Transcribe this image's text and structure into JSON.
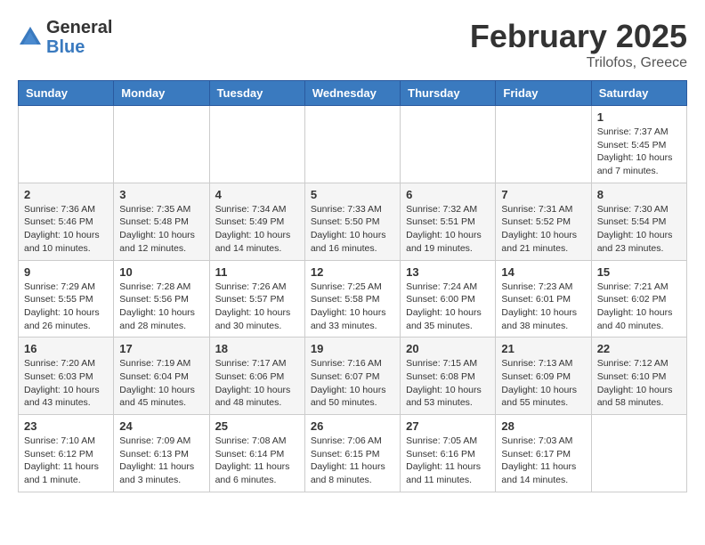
{
  "logo": {
    "general": "General",
    "blue": "Blue"
  },
  "header": {
    "month": "February 2025",
    "location": "Trilofos, Greece"
  },
  "days_of_week": [
    "Sunday",
    "Monday",
    "Tuesday",
    "Wednesday",
    "Thursday",
    "Friday",
    "Saturday"
  ],
  "weeks": [
    [
      {
        "day": "",
        "info": ""
      },
      {
        "day": "",
        "info": ""
      },
      {
        "day": "",
        "info": ""
      },
      {
        "day": "",
        "info": ""
      },
      {
        "day": "",
        "info": ""
      },
      {
        "day": "",
        "info": ""
      },
      {
        "day": "1",
        "info": "Sunrise: 7:37 AM\nSunset: 5:45 PM\nDaylight: 10 hours and 7 minutes."
      }
    ],
    [
      {
        "day": "2",
        "info": "Sunrise: 7:36 AM\nSunset: 5:46 PM\nDaylight: 10 hours and 10 minutes."
      },
      {
        "day": "3",
        "info": "Sunrise: 7:35 AM\nSunset: 5:48 PM\nDaylight: 10 hours and 12 minutes."
      },
      {
        "day": "4",
        "info": "Sunrise: 7:34 AM\nSunset: 5:49 PM\nDaylight: 10 hours and 14 minutes."
      },
      {
        "day": "5",
        "info": "Sunrise: 7:33 AM\nSunset: 5:50 PM\nDaylight: 10 hours and 16 minutes."
      },
      {
        "day": "6",
        "info": "Sunrise: 7:32 AM\nSunset: 5:51 PM\nDaylight: 10 hours and 19 minutes."
      },
      {
        "day": "7",
        "info": "Sunrise: 7:31 AM\nSunset: 5:52 PM\nDaylight: 10 hours and 21 minutes."
      },
      {
        "day": "8",
        "info": "Sunrise: 7:30 AM\nSunset: 5:54 PM\nDaylight: 10 hours and 23 minutes."
      }
    ],
    [
      {
        "day": "9",
        "info": "Sunrise: 7:29 AM\nSunset: 5:55 PM\nDaylight: 10 hours and 26 minutes."
      },
      {
        "day": "10",
        "info": "Sunrise: 7:28 AM\nSunset: 5:56 PM\nDaylight: 10 hours and 28 minutes."
      },
      {
        "day": "11",
        "info": "Sunrise: 7:26 AM\nSunset: 5:57 PM\nDaylight: 10 hours and 30 minutes."
      },
      {
        "day": "12",
        "info": "Sunrise: 7:25 AM\nSunset: 5:58 PM\nDaylight: 10 hours and 33 minutes."
      },
      {
        "day": "13",
        "info": "Sunrise: 7:24 AM\nSunset: 6:00 PM\nDaylight: 10 hours and 35 minutes."
      },
      {
        "day": "14",
        "info": "Sunrise: 7:23 AM\nSunset: 6:01 PM\nDaylight: 10 hours and 38 minutes."
      },
      {
        "day": "15",
        "info": "Sunrise: 7:21 AM\nSunset: 6:02 PM\nDaylight: 10 hours and 40 minutes."
      }
    ],
    [
      {
        "day": "16",
        "info": "Sunrise: 7:20 AM\nSunset: 6:03 PM\nDaylight: 10 hours and 43 minutes."
      },
      {
        "day": "17",
        "info": "Sunrise: 7:19 AM\nSunset: 6:04 PM\nDaylight: 10 hours and 45 minutes."
      },
      {
        "day": "18",
        "info": "Sunrise: 7:17 AM\nSunset: 6:06 PM\nDaylight: 10 hours and 48 minutes."
      },
      {
        "day": "19",
        "info": "Sunrise: 7:16 AM\nSunset: 6:07 PM\nDaylight: 10 hours and 50 minutes."
      },
      {
        "day": "20",
        "info": "Sunrise: 7:15 AM\nSunset: 6:08 PM\nDaylight: 10 hours and 53 minutes."
      },
      {
        "day": "21",
        "info": "Sunrise: 7:13 AM\nSunset: 6:09 PM\nDaylight: 10 hours and 55 minutes."
      },
      {
        "day": "22",
        "info": "Sunrise: 7:12 AM\nSunset: 6:10 PM\nDaylight: 10 hours and 58 minutes."
      }
    ],
    [
      {
        "day": "23",
        "info": "Sunrise: 7:10 AM\nSunset: 6:12 PM\nDaylight: 11 hours and 1 minute."
      },
      {
        "day": "24",
        "info": "Sunrise: 7:09 AM\nSunset: 6:13 PM\nDaylight: 11 hours and 3 minutes."
      },
      {
        "day": "25",
        "info": "Sunrise: 7:08 AM\nSunset: 6:14 PM\nDaylight: 11 hours and 6 minutes."
      },
      {
        "day": "26",
        "info": "Sunrise: 7:06 AM\nSunset: 6:15 PM\nDaylight: 11 hours and 8 minutes."
      },
      {
        "day": "27",
        "info": "Sunrise: 7:05 AM\nSunset: 6:16 PM\nDaylight: 11 hours and 11 minutes."
      },
      {
        "day": "28",
        "info": "Sunrise: 7:03 AM\nSunset: 6:17 PM\nDaylight: 11 hours and 14 minutes."
      },
      {
        "day": "",
        "info": ""
      }
    ]
  ]
}
